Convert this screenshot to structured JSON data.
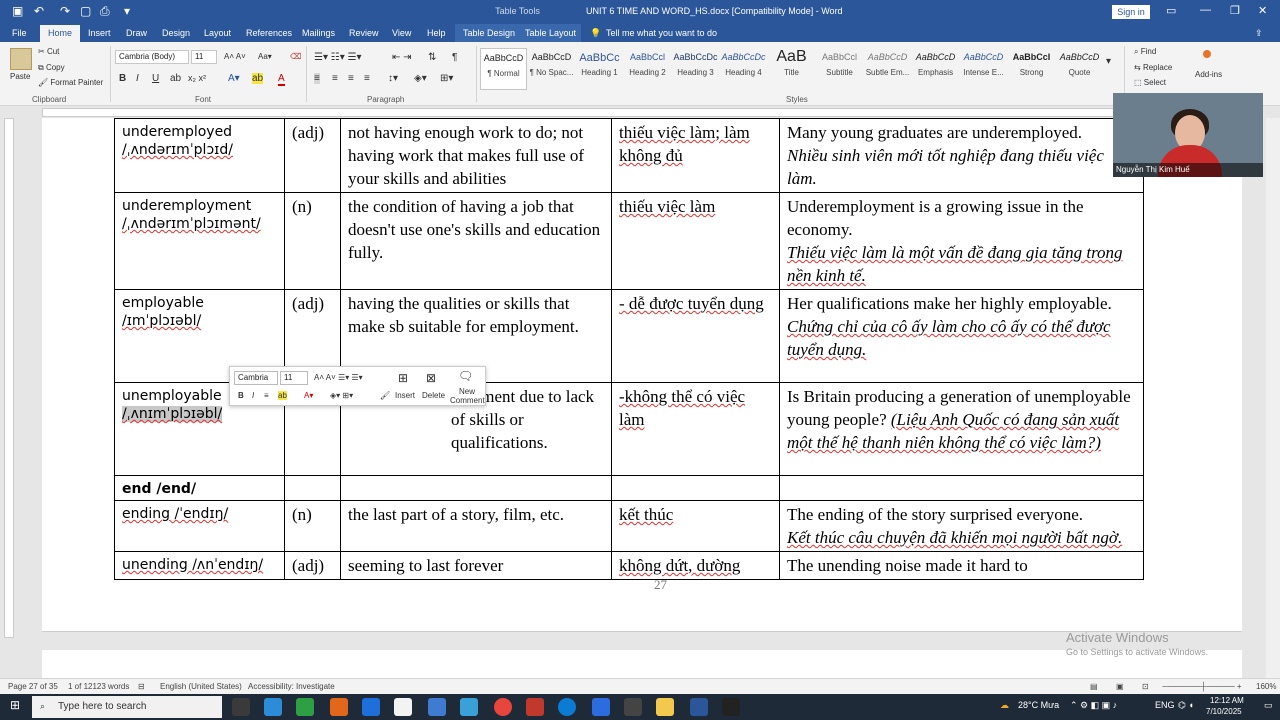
{
  "titlebar": {
    "title": "UNIT 6 TIME AND WORD_HS.docx [Compatibility Mode]  -  Word",
    "table_tools": "Table Tools",
    "signin": "Sign in"
  },
  "tabs": [
    "File",
    "Home",
    "Insert",
    "Draw",
    "Design",
    "Layout",
    "References",
    "Mailings",
    "Review",
    "View",
    "Help",
    "Table Design",
    "Table Layout"
  ],
  "tell_me": "Tell me what you want to do",
  "clipboard": {
    "paste": "Paste",
    "cut": "Cut",
    "copy": "Copy",
    "format_painter": "Format Painter",
    "label": "Clipboard"
  },
  "font": {
    "name": "Cambria (Body)",
    "size": "11",
    "label": "Font"
  },
  "paragraph_label": "Paragraph",
  "styles": {
    "label": "Styles",
    "items": [
      {
        "preview": "AaBbCcD",
        "name": "¶ Normal"
      },
      {
        "preview": "AaBbCcD",
        "name": "¶ No Spac..."
      },
      {
        "preview": "AaBbCc",
        "name": "Heading 1"
      },
      {
        "preview": "AaBbCcl",
        "name": "Heading 2"
      },
      {
        "preview": "AaBbCcDc",
        "name": "Heading 3"
      },
      {
        "preview": "AaBbCcDc",
        "name": "Heading 4"
      },
      {
        "preview": "AaB",
        "name": "Title"
      },
      {
        "preview": "AaBbCcl",
        "name": "Subtitle"
      },
      {
        "preview": "AaBbCcD",
        "name": "Subtle Em..."
      },
      {
        "preview": "AaBbCcD",
        "name": "Emphasis"
      },
      {
        "preview": "AaBbCcD",
        "name": "Intense E..."
      },
      {
        "preview": "AaBbCcI",
        "name": "Strong"
      },
      {
        "preview": "AaBbCcD",
        "name": "Quote"
      }
    ]
  },
  "editing": {
    "find": "Find",
    "replace": "Replace",
    "select": "Select",
    "addins": "Add-ins"
  },
  "table_rows": [
    {
      "word": "underemployed",
      "ipa": "/ˌʌndərɪmˈplɔɪd/",
      "pos": "(adj)",
      "def": "not having enough work to do; not having work that makes full use of your skills and abilities",
      "vn": "thiếu việc làm; làm không đủ",
      "ex": "Many young graduates are underemployed.",
      "ex_vn": "Nhiều sinh viên mới tốt nghiệp đang thiếu việc làm."
    },
    {
      "word": "underemployment",
      "ipa": "/ˌʌndərɪmˈplɔɪmənt/",
      "pos": "(n)",
      "def": "the condition of having a job that doesn't use one's skills and education fully.",
      "vn": "thiếu việc làm",
      "ex": "Underemployment is a growing issue in the economy.",
      "ex_vn": "Thiếu việc làm là một vấn đề đang gia tăng trong nền kinh tế."
    },
    {
      "word": "employable",
      "ipa": "/ɪmˈplɔɪəbl/",
      "pos": "(adj)",
      "def": "having the qualities or skills that make sb suitable for employment.",
      "vn": "- dễ được tuyển dụng",
      "ex": "Her qualifications make her highly employable.",
      "ex_vn": "Chứng chỉ của cô ấy làm cho cô ấy có thể được tuyển dụng."
    },
    {
      "word": "unemployable",
      "ipa": "/ˌʌnɪmˈplɔɪəbl/",
      "pos": "",
      "def": "ployment due to lack of skills or qualifications.",
      "vn": "-không thể có việc làm",
      "ex": "Is Britain producing a generation of unemployable young people?",
      "ex_vn": "(Liệu Anh Quốc có đang sản xuất một thế hệ thanh niên không thể có việc làm?)"
    },
    {
      "word": "end /end/",
      "ipa": "",
      "pos": "",
      "def": "",
      "vn": "",
      "ex": "",
      "ex_vn": ""
    },
    {
      "word": "ending /ˈendɪŋ/",
      "ipa": "",
      "pos": "(n)",
      "def": "the last part of a story, film, etc.",
      "vn": "kết thúc",
      "ex": "The ending of the story surprised everyone.",
      "ex_vn": "Kết thúc câu chuyện đã khiến mọi người bất ngờ."
    },
    {
      "word": "unending /ʌnˈendɪŋ/",
      "ipa": "",
      "pos": "(adj)",
      "def": "seeming to last forever",
      "vn": "không dứt, dường",
      "ex": "The unending noise made it hard to",
      "ex_vn": ""
    }
  ],
  "page_number": "27",
  "mini_toolbar": {
    "font": "Cambria",
    "size": "11",
    "insert": "Insert",
    "delete": "Delete",
    "new_comment": "New Comment"
  },
  "webcam_name": "Nguyễn Thị Kim Huế",
  "activate": {
    "line1": "Activate Windows",
    "line2": "Go to Settings to activate Windows."
  },
  "status": {
    "page": "Page 27 of 35",
    "words": "1 of 12123 words",
    "language": "English (United States)",
    "accessibility": "Accessibility: Investigate",
    "zoom": "160%"
  },
  "taskbar": {
    "search": "Type here to search",
    "weather": "28°C  Mưa",
    "lang": "ENG",
    "time": "12:12 AM",
    "date": "7/10/2025"
  }
}
